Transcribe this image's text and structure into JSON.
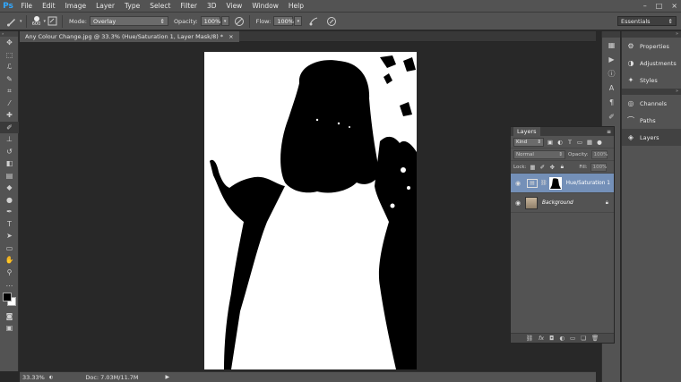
{
  "app": {
    "logo": "Ps"
  },
  "menu": [
    "File",
    "Edit",
    "Image",
    "Layer",
    "Type",
    "Select",
    "Filter",
    "3D",
    "View",
    "Window",
    "Help"
  ],
  "window_controls": [
    "–",
    "□",
    "×"
  ],
  "options": {
    "brush_size": "600",
    "mode_label": "Mode:",
    "mode_value": "Overlay",
    "opacity_label": "Opacity:",
    "opacity_value": "100%",
    "flow_label": "Flow:",
    "flow_value": "100%",
    "workspace": "Essentials"
  },
  "document_tab": {
    "title": "Any Colour Change.jpg @ 33.3% (Hue/Saturation 1, Layer Mask/8) *",
    "close": "×"
  },
  "status": {
    "zoom": "33.33%",
    "doc": "Doc: 7.03M/11.7M"
  },
  "panels": [
    {
      "name": "Properties",
      "icon": "properties-icon"
    },
    {
      "name": "Adjustments",
      "icon": "adjustments-icon"
    },
    {
      "name": "Styles",
      "icon": "styles-icon"
    },
    {
      "name": "Channels",
      "icon": "channels-icon"
    },
    {
      "name": "Paths",
      "icon": "paths-icon"
    },
    {
      "name": "Layers",
      "icon": "layers-icon"
    }
  ],
  "layers_panel": {
    "tab": "Layers",
    "filter": "Kind",
    "blend_mode": "Normal",
    "opacity_label": "Opacity:",
    "opacity_value": "100%",
    "lock_label": "Lock:",
    "fill_label": "Fill:",
    "fill_value": "100%",
    "layers": [
      {
        "name": "Hue/Saturation 1",
        "selected": true
      },
      {
        "name": "Background",
        "selected": false
      }
    ]
  },
  "colors": {
    "accent": "#31a8ff",
    "selection": "#7490b8",
    "panel": "#535353",
    "canvas_bg": "#282828"
  }
}
